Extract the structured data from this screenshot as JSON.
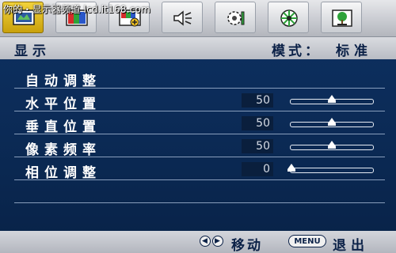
{
  "watermark": "你的・显示器频道 lcd.it168.com",
  "tabs": [
    {
      "name": "display",
      "active": true
    },
    {
      "name": "picture",
      "active": false
    },
    {
      "name": "picture-advanced",
      "active": false
    },
    {
      "name": "audio",
      "active": false
    },
    {
      "name": "system",
      "active": false
    },
    {
      "name": "setup",
      "active": false
    },
    {
      "name": "eco",
      "active": false
    }
  ],
  "header": {
    "title": "显示",
    "mode_label": "模式：",
    "mode_value": "标准"
  },
  "menu": {
    "items": [
      {
        "label": "自动调整"
      },
      {
        "label": "水平位置",
        "value": "50",
        "level": 0.5
      },
      {
        "label": "垂直位置",
        "value": "50",
        "level": 0.5
      },
      {
        "label": "像素频率",
        "value": "50",
        "level": 0.5
      },
      {
        "label": "相位调整",
        "value": "0",
        "level": 0.0
      }
    ]
  },
  "footer": {
    "move_label": "移动",
    "menu_button": "MENU",
    "exit_label": "退出"
  },
  "colors": {
    "accent": "#f2d23a",
    "background": "#0e3163",
    "bar": "#c9cbd1"
  }
}
